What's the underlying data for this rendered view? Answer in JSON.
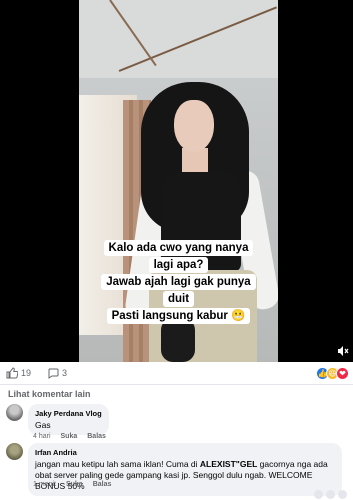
{
  "video": {
    "caption_lines": [
      "Kalo ada cwo yang nanya",
      "lagi apa?",
      "Jawab ajah lagi gak punya",
      "duit",
      "Pasti langsung kabur 😬"
    ],
    "mute_icon": "speaker-mute-icon"
  },
  "reactions": {
    "like_count": "19",
    "comment_count": "3",
    "like_icon": "thumbs-up-icon",
    "comment_icon": "comment-icon",
    "emoji_icons": [
      "like-reaction-icon",
      "haha-reaction-icon",
      "love-reaction-icon"
    ]
  },
  "comments_header": {
    "label": "Lihat komentar lain"
  },
  "comments": [
    {
      "author": "Jaky Perdana Vlog",
      "text": "Gas",
      "time": "4 hari",
      "like_label": "Suka",
      "reply_label": "Balas"
    },
    {
      "author": "Irfan Andria",
      "text_before": "jangan mau ketipu lah sama iklan! Cuma di ",
      "text_bold": "ALEXIST\"GEL",
      "text_after": " gacornya nga ada obat server paling gede gampang kasi jp. Senggol dulu ngab. WELCOME BONUS 50%",
      "time": "1 menit",
      "like_label": "Suka",
      "reply_label": "Balas"
    }
  ],
  "colors": {
    "like_blue": "#1877f2",
    "haha_yellow": "#f7b928",
    "love_red": "#f02849",
    "muted_text": "#65676b",
    "bubble_bg": "#f0f2f5"
  }
}
